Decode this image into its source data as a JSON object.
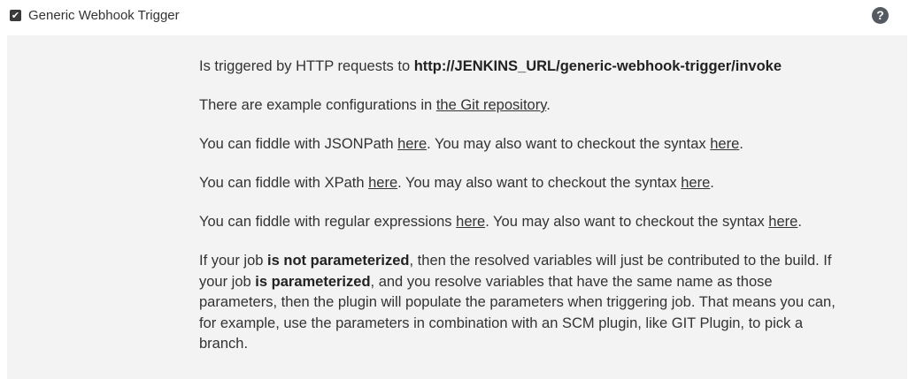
{
  "trigger": {
    "checked": true,
    "checkbox_glyph": "✔",
    "label": "Generic Webhook Trigger",
    "help_glyph": "?"
  },
  "help": {
    "p1": {
      "text": "Is triggered by HTTP requests to ",
      "url": "http://JENKINS_URL/generic-webhook-trigger/invoke"
    },
    "p2": {
      "before": "There are example configurations in ",
      "link": "the Git repository",
      "after": "."
    },
    "p3": {
      "before": "You can fiddle with JSONPath ",
      "link1": "here",
      "middle": ". You may also want to checkout the syntax ",
      "link2": "here",
      "after": "."
    },
    "p4": {
      "before": "You can fiddle with XPath ",
      "link1": "here",
      "middle": ". You may also want to checkout the syntax ",
      "link2": "here",
      "after": "."
    },
    "p5": {
      "before": "You can fiddle with regular expressions ",
      "link1": "here",
      "middle": ". You may also want to checkout the syntax ",
      "link2": "here",
      "after": "."
    },
    "p6": {
      "t1": "If your job ",
      "b1": "is not parameterized",
      "t2": ", then the resolved variables will just be contributed to the build. If your job ",
      "b2": "is parameterized",
      "t3": ", and you resolve variables that have the same name as those parameters, then the plugin will populate the parameters when triggering job. That means you can, for example, use the parameters in combination with an SCM plugin, like GIT Plugin, to pick a branch."
    }
  }
}
